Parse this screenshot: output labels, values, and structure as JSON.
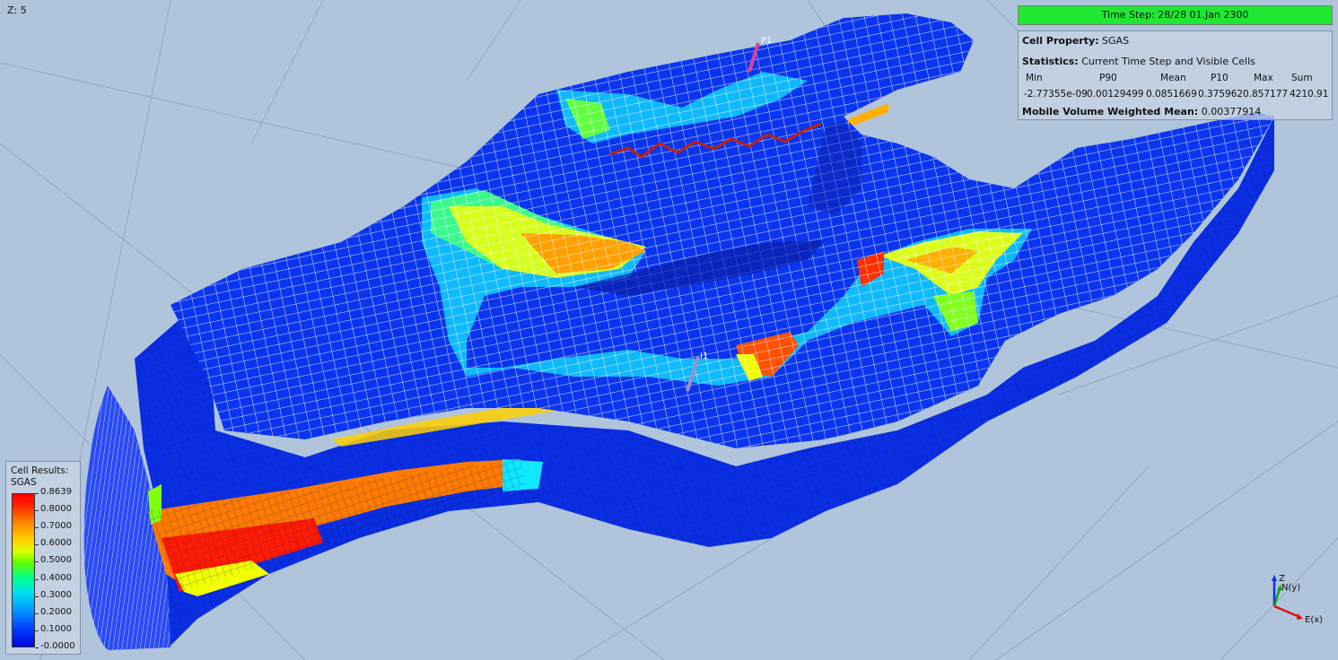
{
  "view": {
    "z_label": "Z: 5",
    "time_step": "Time Step: 28/28 01.Jan 2300",
    "wells": [
      "P1",
      "I1"
    ]
  },
  "info": {
    "cell_property_label": "Cell Property:",
    "cell_property_value": "SGAS",
    "statistics_label": "Statistics:",
    "statistics_value": "Current Time Step and Visible Cells",
    "headers": [
      "Min",
      "P90",
      "Mean",
      "P10",
      "Max",
      "Sum"
    ],
    "values": [
      "-2.77355e-09",
      "0.00129499",
      "0.0851669",
      "0.375962",
      "0.857177",
      "4210.91"
    ],
    "mvwm_label": "Mobile Volume Weighted Mean:",
    "mvwm_value": "0.00377914"
  },
  "legend": {
    "title_line1": "Cell Results:",
    "title_line2": "SGAS",
    "ticks": [
      "0.8639",
      "0.8000",
      "0.7000",
      "0.6000",
      "0.5000",
      "0.4000",
      "0.3000",
      "0.2000",
      "0.1000",
      "-0.0000"
    ]
  },
  "axes": {
    "z": "Z",
    "y": "N(y)",
    "x": "E(x)"
  },
  "colors": {
    "background": "#b0c4dc",
    "time_step_bar": "#1ee832",
    "grid_blue": "#0a2ee6"
  }
}
